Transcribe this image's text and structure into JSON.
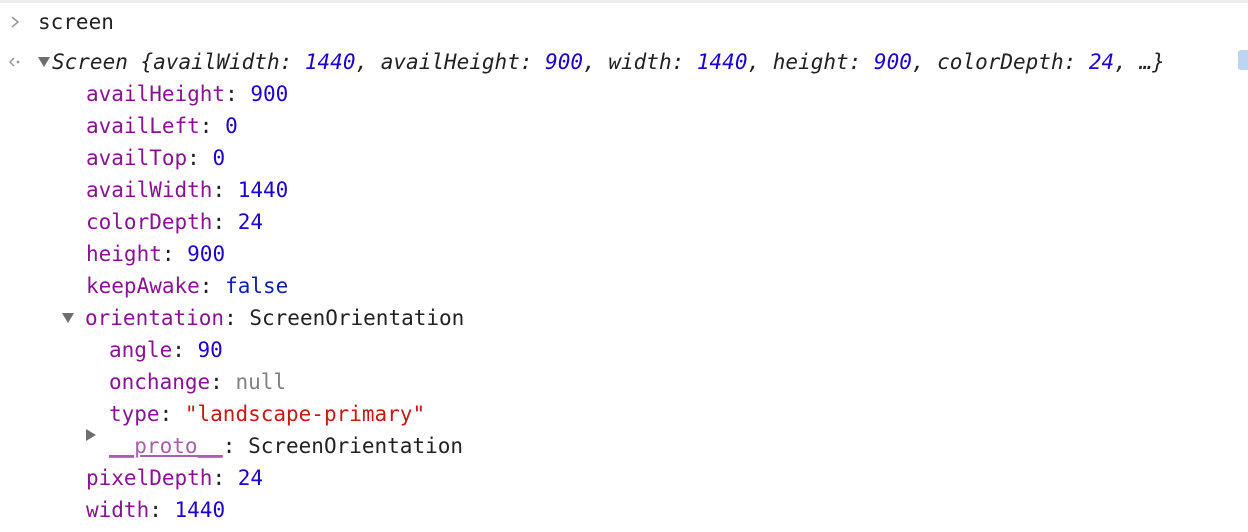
{
  "command": {
    "text": "screen"
  },
  "summary": {
    "type": "Screen",
    "open_brace": " {",
    "pairs": [
      {
        "key": "availWidth",
        "value": "1440"
      },
      {
        "key": "availHeight",
        "value": "900"
      },
      {
        "key": "width",
        "value": "1440"
      },
      {
        "key": "height",
        "value": "900"
      },
      {
        "key": "colorDepth",
        "value": "24"
      }
    ],
    "ellipsis": "…}"
  },
  "props": [
    {
      "key": "availHeight",
      "value": "900",
      "kind": "num"
    },
    {
      "key": "availLeft",
      "value": "0",
      "kind": "num"
    },
    {
      "key": "availTop",
      "value": "0",
      "kind": "num"
    },
    {
      "key": "availWidth",
      "value": "1440",
      "kind": "num"
    },
    {
      "key": "colorDepth",
      "value": "24",
      "kind": "num"
    },
    {
      "key": "height",
      "value": "900",
      "kind": "num"
    },
    {
      "key": "keepAwake",
      "value": "false",
      "kind": "bool"
    }
  ],
  "orientation": {
    "key": "orientation",
    "value": "ScreenOrientation",
    "children": [
      {
        "key": "angle",
        "value": "90",
        "kind": "num"
      },
      {
        "key": "onchange",
        "value": "null",
        "kind": "null"
      },
      {
        "key": "type",
        "value": "\"landscape-primary\"",
        "kind": "str"
      }
    ],
    "proto": {
      "key": "__proto__",
      "value": "ScreenOrientation"
    }
  },
  "tail_props": [
    {
      "key": "pixelDepth",
      "value": "24",
      "kind": "num"
    },
    {
      "key": "width",
      "value": "1440",
      "kind": "num"
    }
  ],
  "colors": {
    "key": "#881391",
    "number": "#1c00cf",
    "string": "#c41a16",
    "null": "#808080"
  }
}
